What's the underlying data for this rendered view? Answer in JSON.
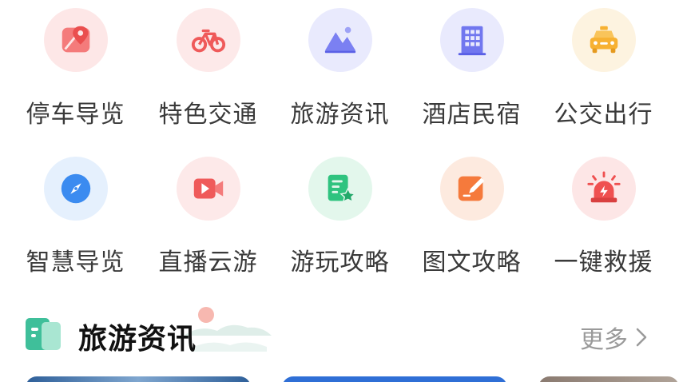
{
  "grid": {
    "row1": [
      {
        "label": "停车导览",
        "icon": "parking-map-icon",
        "color": "#f06767",
        "bg": "#fde7e7"
      },
      {
        "label": "特色交通",
        "icon": "bicycle-icon",
        "color": "#ef5a5a",
        "bg": "#fde9e9"
      },
      {
        "label": "旅游资讯",
        "icon": "mountain-icon",
        "color": "#6b72ee",
        "bg": "#e9eafd"
      },
      {
        "label": "酒店民宿",
        "icon": "building-icon",
        "color": "#6c73ef",
        "bg": "#e9eafd"
      },
      {
        "label": "公交出行",
        "icon": "taxi-icon",
        "color": "#f7b132",
        "bg": "#fdf3e0"
      }
    ],
    "row2": [
      {
        "label": "智慧导览",
        "icon": "compass-icon",
        "color": "#3b8bf0",
        "bg": "#e5f0fd"
      },
      {
        "label": "直播云游",
        "icon": "video-camera-icon",
        "color": "#ef5a5a",
        "bg": "#fde9e9"
      },
      {
        "label": "游玩攻略",
        "icon": "document-star-icon",
        "color": "#2fc37f",
        "bg": "#e3f7ec"
      },
      {
        "label": "图文攻略",
        "icon": "edit-note-icon",
        "color": "#f57a3c",
        "bg": "#fdeadf"
      },
      {
        "label": "一键救援",
        "icon": "alarm-siren-icon",
        "color": "#ef5050",
        "bg": "#fde6e6"
      }
    ]
  },
  "section": {
    "title": "旅游资讯",
    "more_label": "更多",
    "icon": "news-book-icon",
    "accent": "#3fbf9a"
  },
  "cards": [
    {
      "color": "#3d6fa8"
    },
    {
      "color": "#2f6fd6"
    },
    {
      "color": "#8a7a70"
    }
  ]
}
